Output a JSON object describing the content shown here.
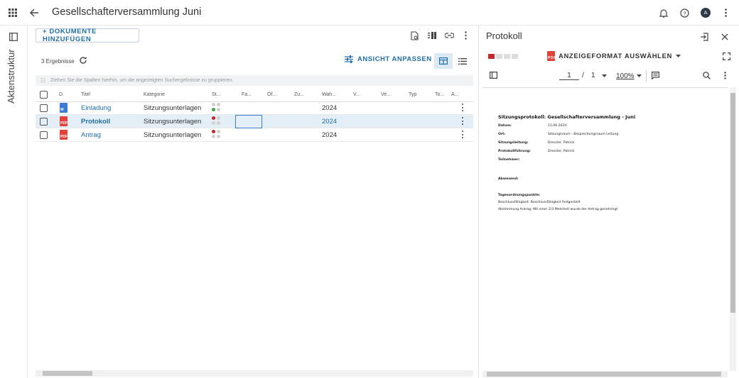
{
  "appbar": {
    "title": "Gesellschafterversammlung Juni",
    "avatar": "A"
  },
  "rail": {
    "label": "Aktenstruktur"
  },
  "toolbar": {
    "add_label": "+ DOKUMENTE HINZUFÜGEN"
  },
  "results": {
    "count_label": "3 Ergebnisse",
    "ansicht_label": "ANSICHT ANPASSEN"
  },
  "groupbar": {
    "text": "Ziehen Sie die Spalten hierhin, um die angezeigten Suchergebnisse zu gruppieren."
  },
  "columns": [
    "D.",
    "Titel",
    "Kategorie",
    "St...",
    "Fa...",
    "Öf...",
    "Zu...",
    "Wah...",
    "V...",
    "Ve...",
    "Typ",
    "To...",
    "A..."
  ],
  "rows": [
    {
      "title": "Einladung",
      "kategorie": "Sitzungsunterlagen",
      "jahr": "2024",
      "doctype": "W",
      "dot": "green",
      "selected": false
    },
    {
      "title": "Protokoll",
      "kategorie": "Sitzungsunterlagen",
      "jahr": "2024",
      "doctype": "PDF",
      "dot": "red",
      "selected": true
    },
    {
      "title": "Antrag",
      "kategorie": "Sitzungsunterlagen",
      "jahr": "2024",
      "doctype": "PDF",
      "dot": "red",
      "selected": false
    }
  ],
  "colors": {
    "accent": "#1f6fa6",
    "pdf": "#e0423a",
    "word": "#3a7bd5",
    "green": "#43a047",
    "red": "#c62828",
    "selected_row": "#e4eef6"
  },
  "side": {
    "title": "Protokoll",
    "format_label": "ANZEIGEFORMAT AUSWÄHLEN",
    "page_current": "1",
    "page_sep": "/",
    "page_total": "1",
    "zoom": "100%"
  },
  "pdf": {
    "title": "Sitzungsprotokoll: Gesellschafterversammlung - Juni",
    "fields": [
      {
        "k": "Datum:",
        "v": "11.06.2024"
      },
      {
        "k": "Ort:",
        "v": "Sitzungsraum - Besprechungsraum Leitung"
      },
      {
        "k": "Sitzungsleitung:",
        "v": "Dressler, Patrick"
      },
      {
        "k": "Protokollführung:",
        "v": "Dressler, Patrick"
      },
      {
        "k": "Teilnehmer:",
        "v": ""
      }
    ],
    "abwesend": "Abwesend:",
    "top": "Tagesordnungspunkte:",
    "line1": "Beschlussfähigkeit: Beschlussfähigkeit festgestellt",
    "line2": "Abstimmung Antrag: Mit einer 2/3 Mehrheit wurde der Antrag genehmigt"
  }
}
